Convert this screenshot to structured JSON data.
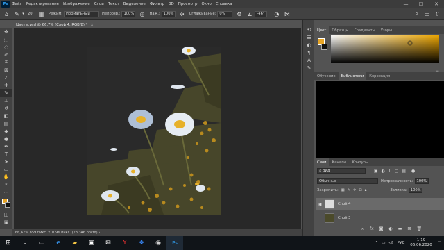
{
  "menubar": {
    "app_logo": "Ps",
    "items": [
      "Файл",
      "Редактирование",
      "Изображение",
      "Слои",
      "Текст",
      "Выделение",
      "Фильтр",
      "3D",
      "Просмотр",
      "Окно",
      "Справка"
    ],
    "min_glyph": "—",
    "max_glyph": "☐",
    "close_glyph": "✕"
  },
  "options": {
    "brush_size": "20",
    "mode_label": "Режим:",
    "mode_value": "Нормальный",
    "opacity_label": "Непрозр.:",
    "opacity_value": "100%",
    "pressure_label": "Наж.:",
    "pressure_value": "100%",
    "smoothing_label": "Сглаживание:",
    "smoothing_value": "0%",
    "angle_value": "-46°"
  },
  "document": {
    "tab_title": "Цветы.psd @ 66,7% (Слой 4, RGB/8) *",
    "close": "×",
    "status": "66,67%   859 пикс. x 1096 пикс. (28,346 ppcm)   ›"
  },
  "panels": {
    "color_tabs": [
      "Цвет",
      "Образцы",
      "Градиенты",
      "Узоры"
    ],
    "mid_tabs": [
      "Обучение",
      "Библиотеки",
      "Коррекция"
    ],
    "layer_tabs": [
      "Слои",
      "Каналы",
      "Контуры"
    ],
    "colors": {
      "foreground": "#e7a526",
      "background": "#111111"
    }
  },
  "layers": {
    "filter_label": "Вид",
    "blend_mode": "Обычные",
    "opacity_label": "Непрозрачность:",
    "opacity_value": "100%",
    "lock_label": "Закрепить:",
    "fill_label": "Заливка:",
    "fill_value": "100%",
    "rows": [
      {
        "name": "Слой 4",
        "visible_glyph": "◉"
      },
      {
        "name": "Слой 3",
        "visible_glyph": ""
      }
    ]
  },
  "taskbar": {
    "lang": "РУС",
    "time": "1:19",
    "date": "06.06.2020"
  }
}
